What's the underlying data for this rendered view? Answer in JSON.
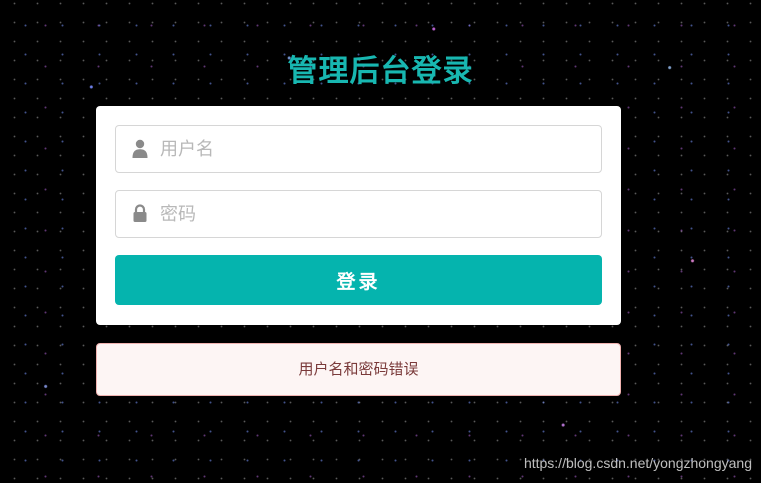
{
  "page": {
    "title": "管理后台登录",
    "background": "#000000",
    "accent_color": "#05b4ae"
  },
  "form": {
    "username": {
      "placeholder": "用户名",
      "value": "",
      "icon": "user-icon"
    },
    "password": {
      "placeholder": "密码",
      "value": "",
      "icon": "lock-icon"
    },
    "submit_label": "登录"
  },
  "alert": {
    "message": "用户名和密码错误",
    "type": "error"
  },
  "watermark": {
    "text": "https://blog.csdn.net/yongzhongyang"
  }
}
